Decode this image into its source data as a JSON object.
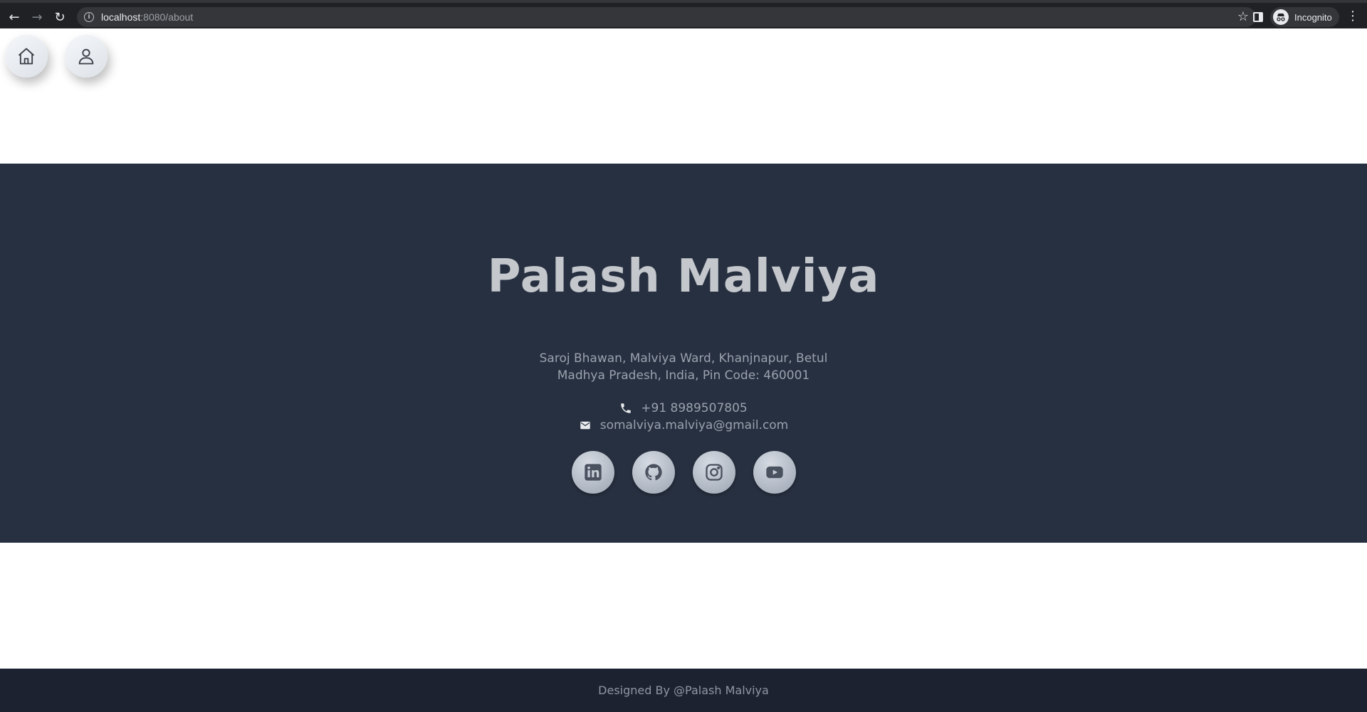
{
  "browser": {
    "url_host": "localhost",
    "url_path": ":8080/about",
    "profile_label": "Incognito"
  },
  "nav": {
    "home_icon": "home-icon",
    "user_icon": "user-icon"
  },
  "profile": {
    "name": "Palash Malviya",
    "address_line1": "Saroj Bhawan, Malviya Ward, Khanjnapur, Betul",
    "address_line2": "Madhya Pradesh, India, Pin Code: 460001",
    "phone": "+91 8989507805",
    "email": "somalviya.malviya@gmail.com"
  },
  "socials": [
    {
      "icon": "linkedin-icon"
    },
    {
      "icon": "github-icon"
    },
    {
      "icon": "instagram-icon"
    },
    {
      "icon": "youtube-icon"
    }
  ],
  "footer": {
    "credit": "Designed By @Palash Malviya"
  },
  "colors": {
    "footer_bg": "#273040",
    "copyright_bg": "#1c2230",
    "name_text": "#c4c7cc"
  }
}
